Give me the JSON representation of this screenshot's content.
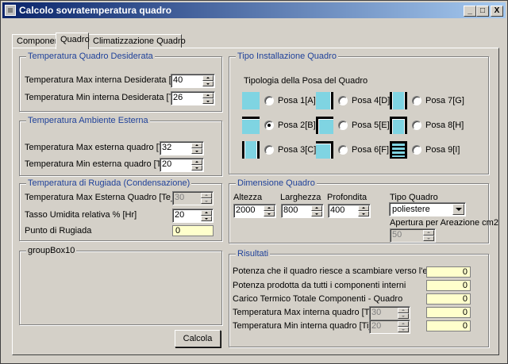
{
  "window": {
    "title": "Calcolo sovratemperatura quadro",
    "icon": "app-window-icon"
  },
  "titlebar_buttons": {
    "minimize": "_",
    "maximize": "□",
    "close": "X"
  },
  "tabs": [
    "Componenti",
    "Quadro",
    "Climatizzazione Quadro"
  ],
  "active_tab": "Quadro",
  "desired_temp": {
    "title": "Temperatura Quadro Desiderata",
    "max_label": "Temperatura Max interna Desiderata [Td_max]",
    "max_value": "40",
    "min_label": "Temperatura Min interna Desiderata [Td_min]",
    "min_value": "26"
  },
  "ambient_temp": {
    "title": "Temperatura Ambiente Esterna",
    "max_label": "Temperatura Max esterna quadro [Te_max]",
    "max_value": "32",
    "min_label": "Temperatura Min esterna quadro [Te_min]",
    "min_value": "20"
  },
  "dew": {
    "title": "Temperatura di Rugiada (Condensazione)",
    "max_label": "Temperatura Max Esterna Quadro [Te_max]",
    "max_value": "30",
    "humidity_label": "Tasso Umidita relativa % [Hr]",
    "humidity_value": "20",
    "dew_label": "Punto di Rugiada",
    "dew_value": "0"
  },
  "groupbox10": {
    "title": "groupBox10"
  },
  "calc_button": "Calcola",
  "installation": {
    "title": "Tipo Installazione  Quadro",
    "subtitle": "Tipologia della Posa del Quadro",
    "selected": "Posa 2[B]",
    "poses": [
      {
        "label": "Posa 1[A]"
      },
      {
        "label": "Posa 4[D]"
      },
      {
        "label": "Posa 7[G]"
      },
      {
        "label": "Posa 2[B]"
      },
      {
        "label": "Posa 5[E]"
      },
      {
        "label": "Posa 8[H]"
      },
      {
        "label": "Posa 3[C]"
      },
      {
        "label": "Posa 6[F]"
      },
      {
        "label": "Posa 9[I]"
      }
    ]
  },
  "dimensions": {
    "title": "Dimensione Quadro",
    "height_label": "Altezza",
    "height_value": "2000",
    "width_label": "Larghezza",
    "width_value": "800",
    "depth_label": "Profondita",
    "depth_value": "400",
    "type_label": "Tipo Quadro",
    "type_value": "poliestere",
    "vent_label": "Apertura per Areazione cm2",
    "vent_value": "50"
  },
  "results": {
    "title": "Risultati",
    "power_exchange_label": "Potenza che il quadro riesce a scambiare verso l'esterno [W]",
    "power_exchange_value": "0",
    "power_produced_label": "Potenza prodotta da tutti i componenti interni",
    "power_produced_value": "0",
    "thermal_load_label": "Carico Termico Totale  Componenti - Quadro",
    "thermal_load_value": "0",
    "ti_max_label": "Temperatura Max interna quadro [Ti_max]",
    "ti_max_spin": "30",
    "ti_max_value": "0",
    "ti_min_label": "Temperatura Min interna quadro [Ti_min]",
    "ti_min_spin": "20",
    "ti_min_value": "0"
  },
  "colors": {
    "accent_text": "#20429a",
    "pose_fill": "#7fd4e2",
    "readout_bg": "#ffffcc",
    "titlebar_start": "#0a246a",
    "titlebar_end": "#a6caf0"
  }
}
